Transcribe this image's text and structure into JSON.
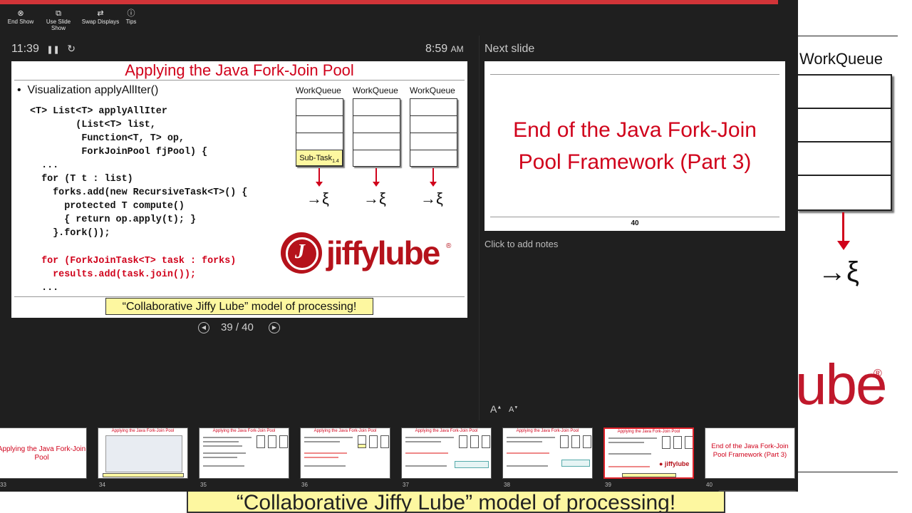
{
  "toolbar": {
    "end_show": "End Show",
    "use_slide_show": "Use Slide Show",
    "swap_displays": "Swap Displays",
    "tips": "Tips"
  },
  "timer": "11:39",
  "clock": {
    "time": "8:59",
    "ampm": "AM"
  },
  "current_slide": {
    "title": "Applying the Java Fork-Join Pool",
    "bullet": "Visualization applyAllIter()",
    "code_black": "<T> List<T> applyAllIter\n        (List<T> list,\n         Function<T, T> op,\n         ForkJoinPool fjPool) {\n  ...\n  for (T t : list)\n    forks.add(new RecursiveTask<T>() {\n      protected T compute()\n      { return op.apply(t); }\n    }.fork());",
    "code_red": "  for (ForkJoinTask<T> task : forks)\n    results.add(task.join());",
    "code_tail": "  ...",
    "workqueue_labels": [
      "WorkQueue",
      "WorkQueue",
      "WorkQueue"
    ],
    "subtask_label": "Sub-Task",
    "subtask_sub": "1.4",
    "logo_text": "jiffylube",
    "banner": "“Collaborative Jiffy Lube” model of processing!"
  },
  "slide_counter": "39 / 40",
  "next_slide": {
    "label": "Next slide",
    "title_line1": "End of the Java Fork-Join",
    "title_line2": "Pool Framework (Part 3)",
    "number": "40"
  },
  "notes_placeholder": "Click to add notes",
  "font_buttons": {
    "increase": "A",
    "decrease": "A"
  },
  "filmstrip": {
    "numbers": [
      "33",
      "34",
      "35",
      "36",
      "37",
      "38",
      "39",
      "40"
    ],
    "slide33_title": "Applying the Java Fork-Join Pool",
    "slide40_title": "End of the Java Fork-Join Pool Framework (Part 3)"
  },
  "background": {
    "workqueue": "WorkQueue",
    "logo_fragment": "ube",
    "banner": "“Collaborative Jiffy Lube” model of processing!"
  },
  "colors": {
    "accent": "#d13438",
    "slide_red": "#d0021b",
    "highlight": "#fdf7a0",
    "bg": "#1f1f1f"
  }
}
